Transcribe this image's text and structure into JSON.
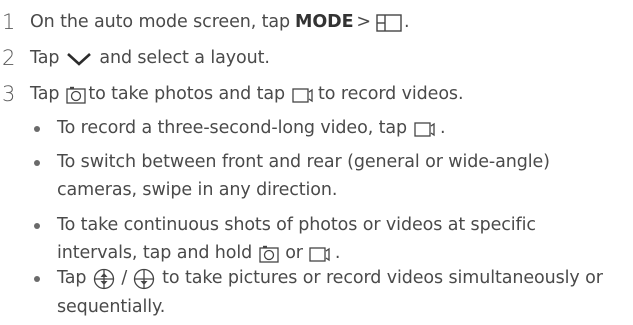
{
  "step1": {
    "number": "1",
    "text_before": "On the auto mode screen, tap",
    "mode_label": "MODE",
    "arrow": ">",
    "end": "."
  },
  "step2": {
    "number": "2",
    "text_before": "Tap",
    "text_after": "and select a layout."
  },
  "step3": {
    "number": "3",
    "text_before": "Tap",
    "text_middle": "to take photos and tap",
    "text_after": "to record videos."
  },
  "bullets": {
    "b1": {
      "text_before": "To record a three-second-long video, tap",
      "end": "."
    },
    "b2": {
      "line1": "To switch between front and rear (general or wide-angle)",
      "line2": "cameras, swipe in any direction."
    },
    "b3": {
      "line1": "To take continuous shots of photos or videos at specific",
      "line2_before": "intervals, tap and hold",
      "line2_or": "or",
      "end": "."
    },
    "b4": {
      "text_before": "Tap",
      "slash": "/",
      "text_after": "to take pictures or record videos simultaneously or",
      "line2": "sequentially."
    }
  },
  "icons": {
    "layout": "layout-grid-icon",
    "chevron": "chevron-down-icon",
    "camera": "camera-shutter-icon",
    "video": "video-record-icon",
    "simultaneous": "simultaneous-mode-icon",
    "sequential": "sequential-mode-icon"
  }
}
